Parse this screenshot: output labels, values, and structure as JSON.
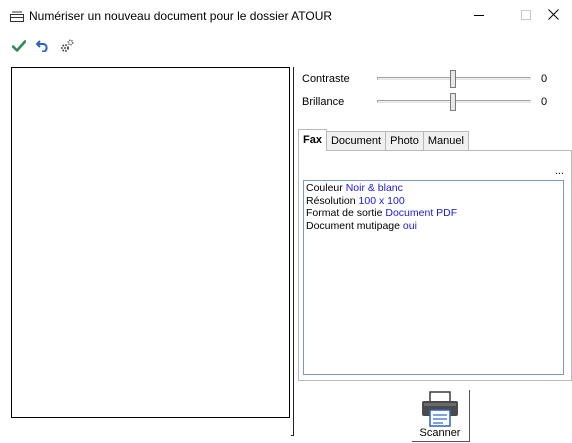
{
  "window": {
    "title": "Numériser un nouveau document pour le dossier ATOUR",
    "controls": {
      "minimize": "minimize-icon",
      "maximize": "maximize-icon",
      "close": "close-icon"
    }
  },
  "toolbar": {
    "items": [
      {
        "icon": "checkmark-icon",
        "color": "#2e8b57"
      },
      {
        "icon": "undo-icon",
        "color": "#2a62c9"
      },
      {
        "icon": "gears-icon",
        "color": "#555555"
      }
    ]
  },
  "sliders": {
    "contrast": {
      "label": "Contraste",
      "value": "0",
      "level": 0.5
    },
    "brightness": {
      "label": "Brillance",
      "value": "0",
      "level": 0.5
    }
  },
  "tabs": [
    {
      "label": "Fax",
      "active": true
    },
    {
      "label": "Document",
      "active": false
    },
    {
      "label": "Photo",
      "active": false
    },
    {
      "label": "Manuel",
      "active": false
    }
  ],
  "panel": {
    "more_label": "...",
    "settings": [
      {
        "key": "Couleur",
        "value": "Noir & blanc"
      },
      {
        "key": "Résolution",
        "value": "100 x 100"
      },
      {
        "key": "Format de sortie",
        "value": "Document PDF"
      },
      {
        "key": "Document mutipage",
        "value": "oui"
      }
    ]
  },
  "scan_button": {
    "label": "Scanner",
    "icon": "printer-icon"
  },
  "colors": {
    "value_text": "#1a1ad8",
    "box_border": "#7a9cc4"
  }
}
